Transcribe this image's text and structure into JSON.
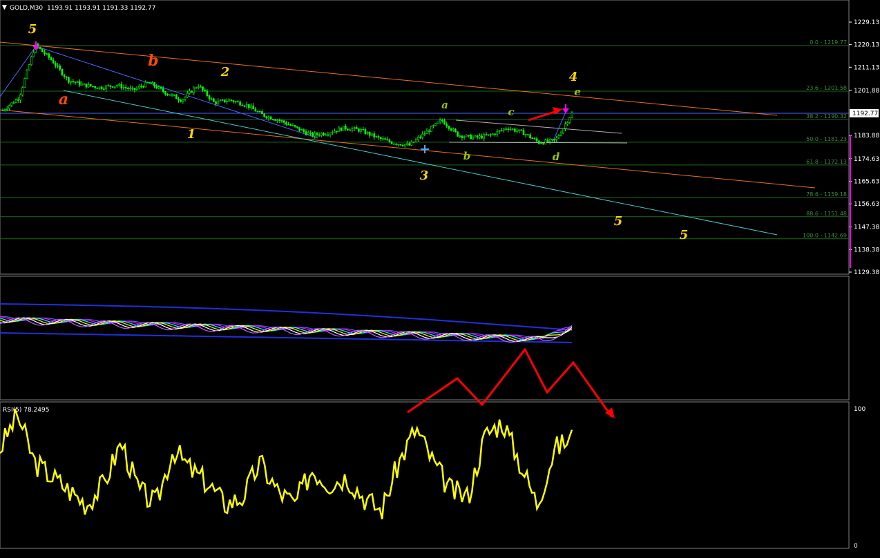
{
  "header": {
    "symbol": "GOLD,M30",
    "ohlc": "1193.91 1193.91 1191.33 1192.77",
    "dropdown_icon": "triangle-down-icon"
  },
  "colors": {
    "background": "#000000",
    "grid": "#1a6b1a",
    "candles": "#00ff00",
    "fib_text": "#3a8d3a",
    "orange_trend": "#e8701f",
    "cyan_trend": "#4ac9c9",
    "blue_trend": "#4a66ff",
    "rsi_line": "#ffff00",
    "annotation_red": "#ff0000",
    "wave_yellow": "#ffd400",
    "wave_orange": "#ff4a00",
    "wave_green": "#9ac800",
    "pink_arrow": "#ff00ff"
  },
  "price_axis": {
    "ticks": [
      "1229.13",
      "1220.13",
      "1211.13",
      "1201.88",
      "1183.88",
      "1174.63",
      "1165.63",
      "1156.63",
      "1147.38",
      "1138.38",
      "1129.38"
    ],
    "current_price": "1192.77"
  },
  "fib_levels": [
    {
      "label": "0.0 - 1219.77",
      "price": 1219.77
    },
    {
      "label": "23.6 - 1201.58",
      "price": 1201.58
    },
    {
      "label": "38.2 - 1190.32",
      "price": 1190.32
    },
    {
      "label": "50.0 - 1181.23",
      "price": 1181.23
    },
    {
      "label": "61.8 - 1172.13",
      "price": 1172.13
    },
    {
      "label": "78.6 - 1159.18",
      "price": 1159.18
    },
    {
      "label": "88.6 - 1151.48",
      "price": 1151.48
    },
    {
      "label": "100.0 - 1142.69",
      "price": 1142.69
    }
  ],
  "wave_labels": [
    {
      "text": "5",
      "color": "wave_yellow"
    },
    {
      "text": "b",
      "color": "wave_orange"
    },
    {
      "text": "2",
      "color": "wave_yellow"
    },
    {
      "text": "a",
      "color": "wave_orange"
    },
    {
      "text": "1",
      "color": "wave_yellow"
    },
    {
      "text": "a",
      "color": "wave_green"
    },
    {
      "text": "c",
      "color": "wave_green"
    },
    {
      "text": "4",
      "color": "wave_yellow"
    },
    {
      "text": "e",
      "color": "wave_green"
    },
    {
      "text": "b",
      "color": "wave_green"
    },
    {
      "text": "d",
      "color": "wave_green"
    },
    {
      "text": "3",
      "color": "wave_yellow"
    },
    {
      "text": "5",
      "color": "wave_yellow"
    },
    {
      "text": "5",
      "color": "wave_yellow"
    }
  ],
  "rsi": {
    "label": "RSI(5) 78.2495",
    "scale_top": "100",
    "scale_bottom": "0"
  },
  "chart_data": {
    "type": "line",
    "title": "GOLD,M30",
    "series": [
      {
        "name": "GOLD,M30",
        "values": [
          1194,
          1199,
          1220,
          1214,
          1206,
          1204,
          1203,
          1204,
          1202,
          1205,
          1201,
          1198,
          1204,
          1197,
          1198,
          1196,
          1192,
          1190,
          1187,
          1184,
          1185,
          1187,
          1186,
          1183,
          1181,
          1180,
          1185,
          1190,
          1184,
          1183,
          1184,
          1187,
          1185,
          1181,
          1182,
          1192.77
        ]
      },
      {
        "name": "RSI(5)",
        "values": [
          70,
          95,
          60,
          50,
          40,
          30,
          45,
          75,
          40,
          30,
          70,
          55,
          45,
          30,
          35,
          60,
          40,
          30,
          55,
          45,
          50,
          35,
          25,
          60,
          85,
          60,
          40,
          35,
          80,
          90,
          60,
          30,
          70,
          78.2495
        ]
      }
    ],
    "ylim": [
      1129.38,
      1232
    ]
  }
}
